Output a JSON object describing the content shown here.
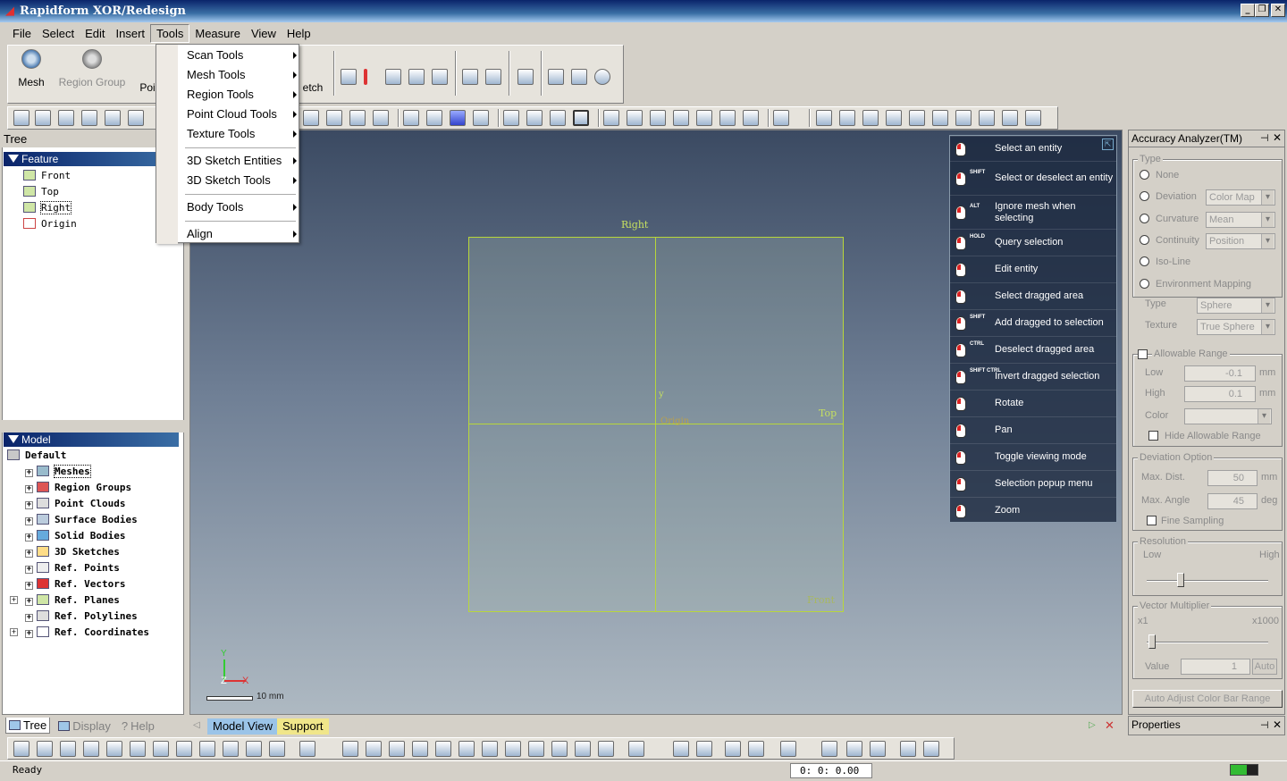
{
  "window": {
    "title": "Rapidform XOR/Redesign",
    "minimize": "_",
    "restore": "❐",
    "close": "✕"
  },
  "menu": [
    "File",
    "Select",
    "Edit",
    "Insert",
    "Tools",
    "Measure",
    "View",
    "Help"
  ],
  "big_toolbar": {
    "mesh": "Mesh",
    "region_group": "Region Group",
    "point_partial": "Poi",
    "sketch_partial": "etch"
  },
  "tools_menu": {
    "items": [
      "Scan Tools",
      "Mesh Tools",
      "Region Tools",
      "Point Cloud Tools",
      "Texture Tools",
      "3D Sketch Entities",
      "3D Sketch Tools",
      "Body Tools",
      "Align"
    ]
  },
  "tree": {
    "title": "Tree",
    "feature_header": "Feature",
    "features": [
      "Front",
      "Top",
      "Right",
      "Origin"
    ],
    "model_header": "Model",
    "default": "Default",
    "model_items": [
      "Meshes",
      "Region Groups",
      "Point Clouds",
      "Surface Bodies",
      "Solid Bodies",
      "3D Sketches",
      "Ref. Points",
      "Ref. Vectors",
      "Ref. Planes",
      "Ref. Polylines",
      "Ref. Coordinates"
    ]
  },
  "left_tabs": [
    "Tree",
    "Display",
    "Help"
  ],
  "viewport": {
    "labels": {
      "right": "Right",
      "top": "Top",
      "front": "Front",
      "origin": "Origin",
      "y": "y"
    },
    "triad": {
      "y": "Y",
      "z": "Z",
      "x": "X"
    },
    "scale": "10 mm",
    "tabs": [
      "Model View",
      "Support"
    ]
  },
  "mouse_help": [
    {
      "mod": "",
      "label": "Select an entity"
    },
    {
      "mod": "SHIFT",
      "label": "Select or deselect an entity"
    },
    {
      "mod": "ALT",
      "label": "Ignore mesh when selecting"
    },
    {
      "mod": "HOLD",
      "label": "Query selection"
    },
    {
      "mod": "",
      "label": "Edit entity"
    },
    {
      "mod": "",
      "label": "Select dragged area"
    },
    {
      "mod": "SHIFT",
      "label": "Add dragged to selection"
    },
    {
      "mod": "CTRL",
      "label": "Deselect dragged area"
    },
    {
      "mod": "SHIFT CTRL",
      "label": "Invert dragged selection"
    },
    {
      "mod": "",
      "label": "Rotate"
    },
    {
      "mod": "",
      "label": "Pan"
    },
    {
      "mod": "",
      "label": "Toggle viewing mode"
    },
    {
      "mod": "",
      "label": "Selection popup menu"
    },
    {
      "mod": "",
      "label": "Zoom"
    }
  ],
  "accuracy": {
    "title": "Accuracy Analyzer(TM)",
    "type_group": "Type",
    "types": [
      "None",
      "Deviation",
      "Curvature",
      "Continuity",
      "Iso-Line",
      "Environment Mapping"
    ],
    "deviation_combo": "Color Map",
    "curvature_combo": "Mean",
    "continuity_combo": "Position",
    "env_type_label": "Type",
    "env_type": "Sphere",
    "texture_label": "Texture",
    "texture": "True Sphere",
    "allowable_range": "Allowable Range",
    "low_label": "Low",
    "low_value": "-0.1",
    "high_label": "High",
    "high_value": "0.1",
    "unit_mm": "mm",
    "color_label": "Color",
    "hide_allowable": "Hide Allowable Range",
    "deviation_option": "Deviation Option",
    "max_dist_label": "Max. Dist.",
    "max_dist": "50",
    "max_angle_label": "Max. Angle",
    "max_angle": "45",
    "deg": "deg",
    "fine_sampling": "Fine Sampling",
    "resolution": "Resolution",
    "res_low": "Low",
    "res_high": "High",
    "vector_multiplier": "Vector Multiplier",
    "vm_min": "x1",
    "vm_max": "x1000",
    "value_label": "Value",
    "value": "1",
    "auto": "Auto",
    "auto_adjust": "Auto Adjust Color Bar Range"
  },
  "properties": {
    "title": "Properties"
  },
  "status": {
    "text": "Ready",
    "time": "0: 0: 0.00"
  }
}
